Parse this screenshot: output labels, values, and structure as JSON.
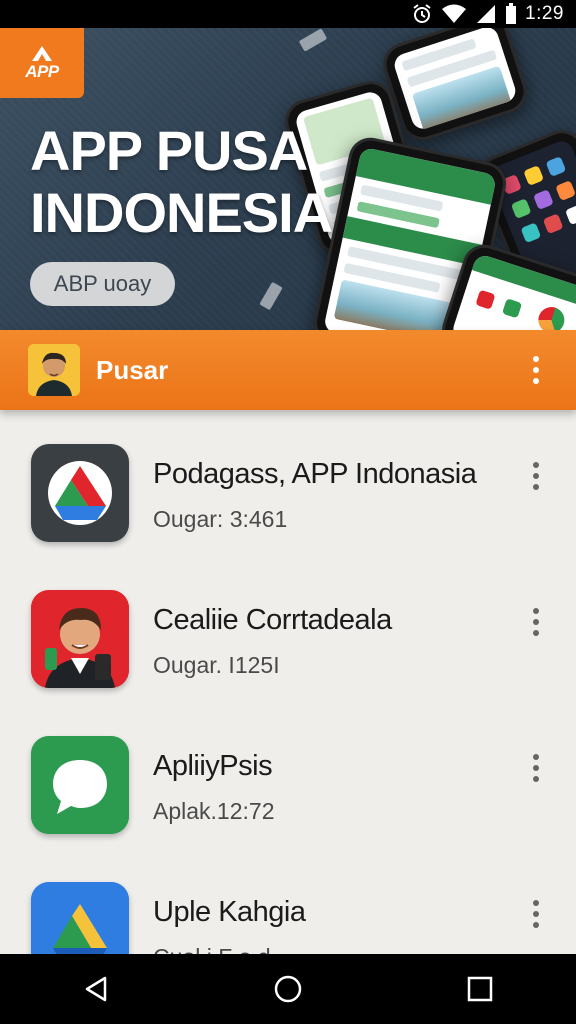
{
  "status_bar": {
    "time": "1:29"
  },
  "hero": {
    "logo_text": "APP",
    "title_line1": "APP PUSA",
    "title_line2": "INDONESIA",
    "button_label": "ABP uoay"
  },
  "section": {
    "title": "Pusar"
  },
  "apps": [
    {
      "name": "Podagass, APP Indonasia",
      "subtitle": "Ougar: 3:461",
      "icon": "drive-icon"
    },
    {
      "name": "Cealiie Corrtadeala",
      "subtitle": "Ougar. I125I",
      "icon": "avatar-icon"
    },
    {
      "name": "ApliiyPsis",
      "subtitle": "Aplak.12:72",
      "icon": "chat-bubble-icon"
    },
    {
      "name": "Uple Kahgia",
      "subtitle": "Cuol i F o d",
      "icon": "drive-icon"
    }
  ],
  "colors": {
    "accent": "#ec7418",
    "hero_bg": "#2d3f50",
    "list_bg": "#efeeeb",
    "green": "#2c9a4f",
    "red": "#e0262c",
    "blue": "#2f7de0"
  }
}
